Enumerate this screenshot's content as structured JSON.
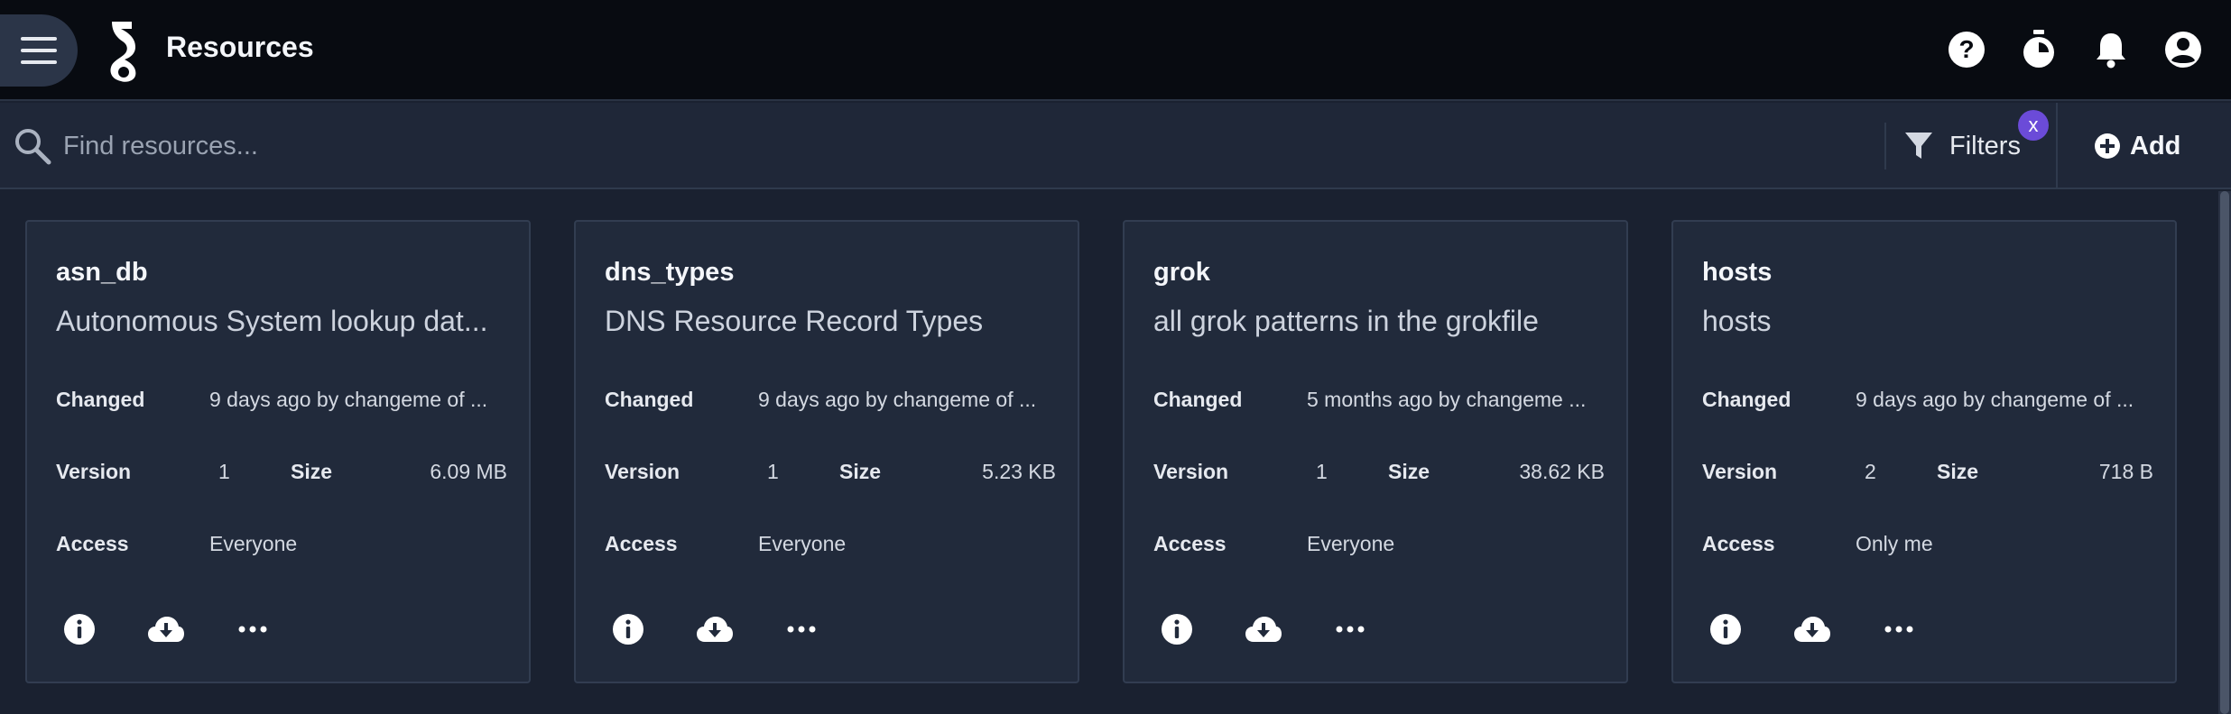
{
  "app": {
    "title": "Resources"
  },
  "search": {
    "placeholder": "Find resources..."
  },
  "toolbar": {
    "filters_label": "Filters",
    "filters_clear": "x",
    "add_label": "Add"
  },
  "colors": {
    "accent": "#6b4bd8",
    "topbar": "#080b11",
    "card": "#212a3b"
  },
  "icons": {
    "menu": "hamburger-icon",
    "help": "help-circle-icon",
    "timer": "stopwatch-icon",
    "notifications": "bell-icon",
    "account": "account-circle-icon",
    "search": "search-icon",
    "filter": "filter-icon",
    "add": "plus-circle-icon",
    "info": "info-icon",
    "download": "cloud-download-icon",
    "more": "more-horizontal-icon"
  },
  "labels": {
    "changed": "Changed",
    "version": "Version",
    "size": "Size",
    "access": "Access"
  },
  "resources": [
    {
      "name": "asn_db",
      "description": "Autonomous System lookup dat...",
      "changed": "9 days ago by changeme of ...",
      "version": "1",
      "size": "6.09 MB",
      "access": "Everyone"
    },
    {
      "name": "dns_types",
      "description": "DNS Resource Record Types",
      "changed": "9 days ago by changeme of ...",
      "version": "1",
      "size": "5.23 KB",
      "access": "Everyone"
    },
    {
      "name": "grok",
      "description": "all grok patterns in the grokfile",
      "changed": "5 months ago by changeme ...",
      "version": "1",
      "size": "38.62 KB",
      "access": "Everyone"
    },
    {
      "name": "hosts",
      "description": "hosts",
      "changed": "9 days ago by changeme of ...",
      "version": "2",
      "size": "718 B",
      "access": "Only me"
    }
  ]
}
